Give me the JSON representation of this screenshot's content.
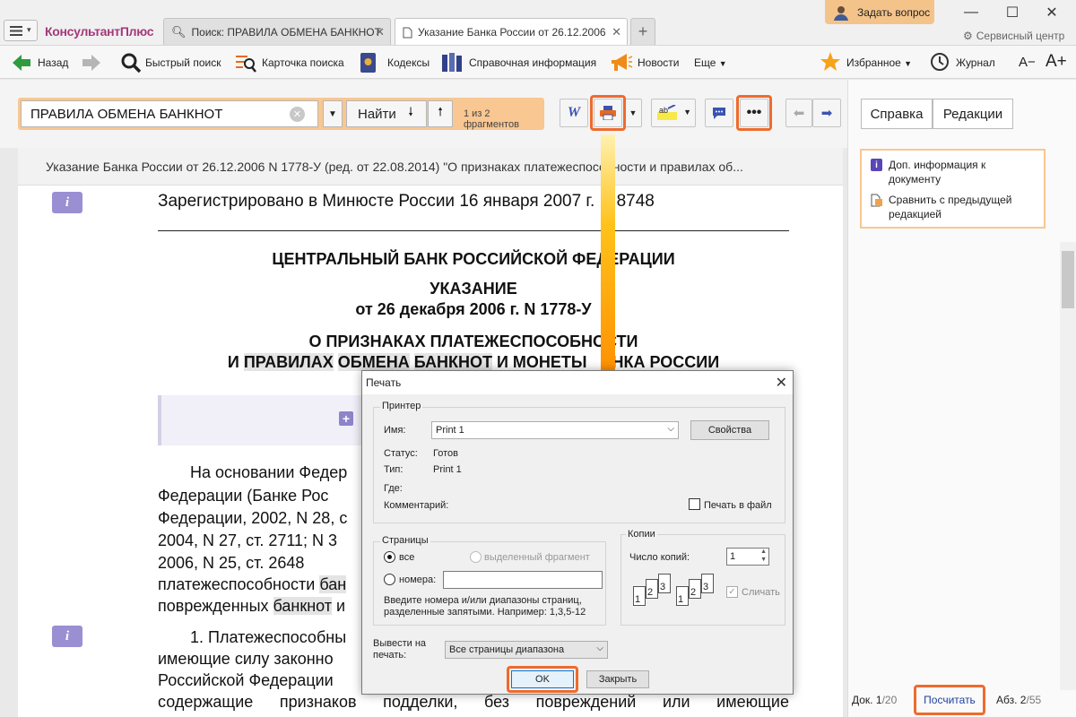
{
  "app": {
    "logo": "КонсультантПлюс"
  },
  "tabs": [
    {
      "label": "Поиск: ПРАВИЛА ОБМЕНА БАНКНОТ"
    },
    {
      "label": "Указание Банка России от 26.12.2006"
    }
  ],
  "header": {
    "ask_question": "Задать вопрос",
    "service_center": "Сервисный центр"
  },
  "toolbar": {
    "back": "Назад",
    "quick_search": "Быстрый поиск",
    "search_card": "Карточка поиска",
    "codes": "Кодексы",
    "reference": "Справочная информация",
    "news": "Новости",
    "more": "Еще",
    "favorites": "Избранное",
    "journal": "Журнал",
    "font_smaller": "A−",
    "font_larger": "A+"
  },
  "search": {
    "value": "ПРАВИЛА ОБМЕНА БАНКНОТ",
    "find_label": "Найти",
    "fragments": "1 из 2 фрагментов"
  },
  "right_panel": {
    "help": "Справка",
    "editions": "Редакции",
    "info_items": [
      "Доп. информация к документу",
      "Сравнить с предыдущей редакцией"
    ],
    "doc_num_label": "Док.",
    "doc_num": "1",
    "doc_total": "/20",
    "count_btn": "Посчитать",
    "abz_label": "Абз.",
    "abz_num": "2",
    "abz_total": "/55"
  },
  "document": {
    "title": "Указание Банка России от 26.12.2006 N 1778-У (ред. от 22.08.2014) \"О признаках платежеспособности и правилах об...",
    "registered": "Зарегистрировано в Минюсте России 16 января 2007 г. N 8748",
    "bank": "ЦЕНТРАЛЬНЫЙ БАНК РОССИЙСКОЙ ФЕДЕРАЦИИ",
    "doc_type": "УКАЗАНИЕ",
    "doc_date": "от 26 декабря 2006 г. N 1778-У",
    "subject_line1": "О ПРИЗНАКАХ ПЛАТЕЖЕСПОСОБНОСТИ",
    "subject_line2_pre": "И ",
    "subject_w1": "ПРАВИЛАХ",
    "subject_w2": "ОБМЕНА",
    "subject_w3": "БАНКНОТ",
    "subject_line2_post": " И МОНЕТЫ   АНКА РОССИИ",
    "para1_lines": [
      "На основании Федер",
      "Федерации (Банке Рос",
      "Федерации, 2002, N 28, с",
      "2004, N 27, ст. 2711; N 3",
      "2006, N 25, ст. 2648"
    ],
    "para1_l6_pre": "платежеспособности ",
    "para1_l6_hl": "бан",
    "para1_l7_pre": "поврежденных ",
    "para1_l7_hl": "банкнот",
    "para1_l7_post": " и",
    "p2_lines": [
      "1. Платежеспособны",
      "имеющие силу законно",
      "Российской Федерации"
    ],
    "p2_last": "содержащие признаков подделки, без повреждений или имеющие"
  },
  "dialog": {
    "title": "Печать",
    "printer_group": "Принтер",
    "name_label": "Имя:",
    "name_value": "Print 1",
    "properties": "Свойства",
    "status_label": "Статус:",
    "status_value": "Готов",
    "type_label": "Тип:",
    "type_value": "Print 1",
    "where_label": "Где:",
    "comment_label": "Комментарий:",
    "print_to_file": "Печать в файл",
    "pages_group": "Страницы",
    "all": "все",
    "selection": "выделенный фрагмент",
    "numbers": "номера:",
    "hint": "Введите номера и/или диапазоны страниц, разделенные запятыми. Например: 1,3,5-12",
    "copies_group": "Копии",
    "copies_label": "Число копий:",
    "copies_value": "1",
    "collate": "Сличать",
    "output_label": "Вывести на печать:",
    "output_value": "Все страницы диапазона",
    "ok": "OK",
    "close": "Закрыть"
  },
  "colors": {
    "accent_orange": "#ee6b2d",
    "highlight_orange": "#f8c792",
    "brand": "#a4387a"
  }
}
